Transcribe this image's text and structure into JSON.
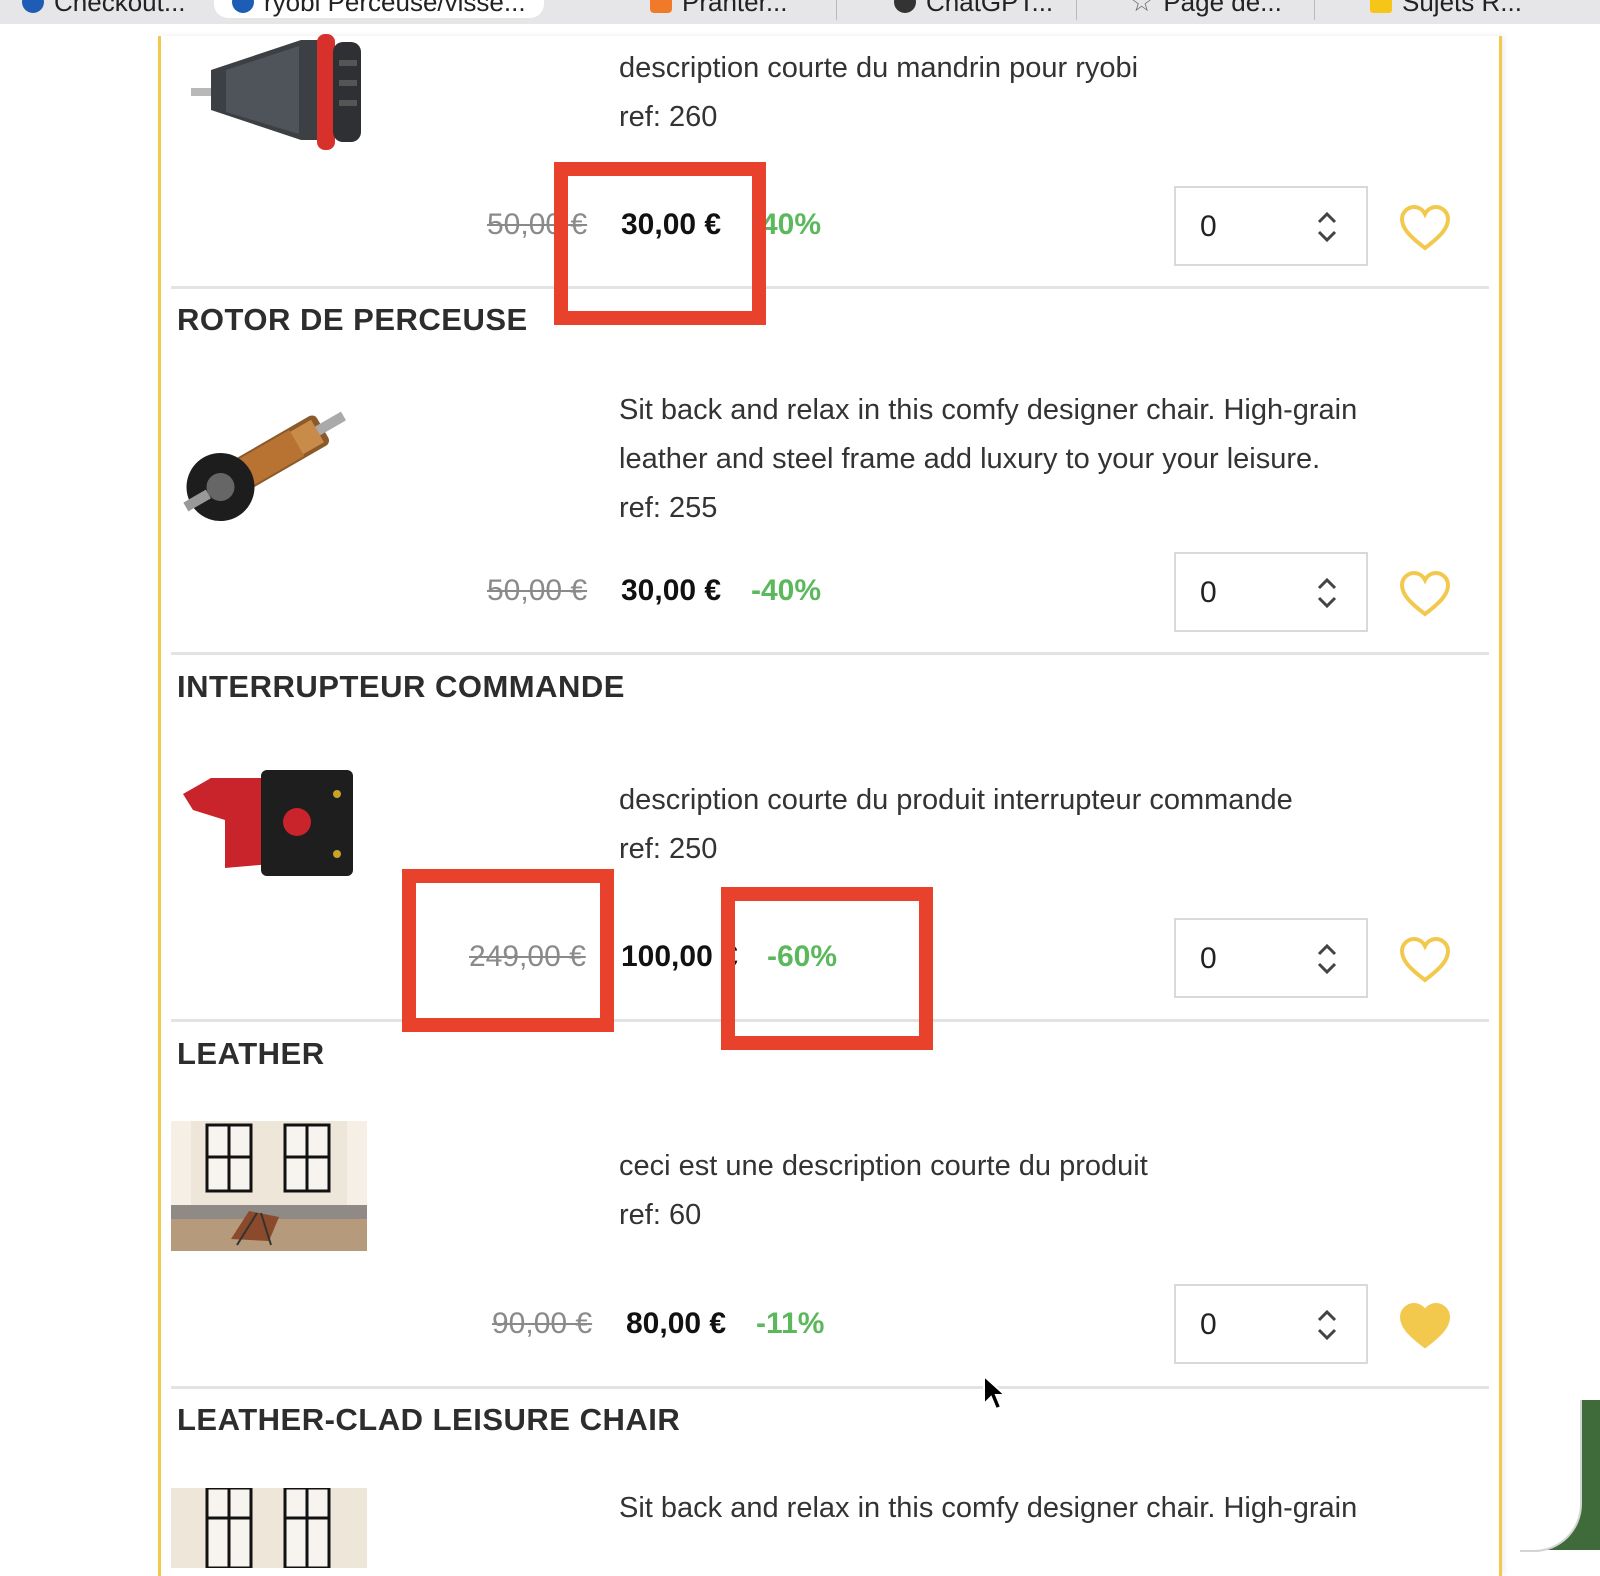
{
  "browser": {
    "tabs": [
      {
        "label": "Checkout..."
      },
      {
        "label": "ryobi Perceuse/visse..."
      },
      {
        "label": "Pranter..."
      },
      {
        "label": "ChatGPT..."
      },
      {
        "label": "Page de..."
      },
      {
        "label": "Sujets R..."
      }
    ]
  },
  "products": [
    {
      "title": "",
      "description": "description courte du mandrin pour ryobi",
      "ref": "ref: 260",
      "old_price": "50,00 €",
      "new_price": "30,00 €",
      "discount": "-40%",
      "quantity": "0",
      "favorite": false,
      "image_icon": "drill-chuck-image"
    },
    {
      "title": "ROTOR DE PERCEUSE",
      "description": "Sit back and relax in this comfy designer chair. High-grain leather and steel frame add luxury to your your leisure.",
      "ref": "ref: 255",
      "old_price": "50,00 €",
      "new_price": "30,00 €",
      "discount": "-40%",
      "quantity": "0",
      "favorite": false,
      "image_icon": "drill-rotor-image"
    },
    {
      "title": "INTERRUPTEUR COMMANDE",
      "description": "description courte du produit interrupteur commande",
      "ref": "ref: 250",
      "old_price": "249,00 €",
      "new_price": "100,00 €",
      "discount": "-60%",
      "quantity": "0",
      "favorite": false,
      "image_icon": "trigger-switch-image"
    },
    {
      "title": "LEATHER",
      "description": "ceci est une description courte du produit",
      "ref": "ref: 60",
      "old_price": "90,00 €",
      "new_price": "80,00 €",
      "discount": "-11%",
      "quantity": "0",
      "favorite": true,
      "image_icon": "leather-chair-room-image"
    },
    {
      "title": "LEATHER-CLAD LEISURE CHAIR",
      "description": "Sit back and relax in this comfy designer chair. High-grain",
      "image_icon": "leather-chair-room-image"
    }
  ],
  "colors": {
    "accent_border": "#f2c94c",
    "heart": "#f2c94c",
    "discount": "#5cb85c",
    "annotation": "#e8412c"
  }
}
